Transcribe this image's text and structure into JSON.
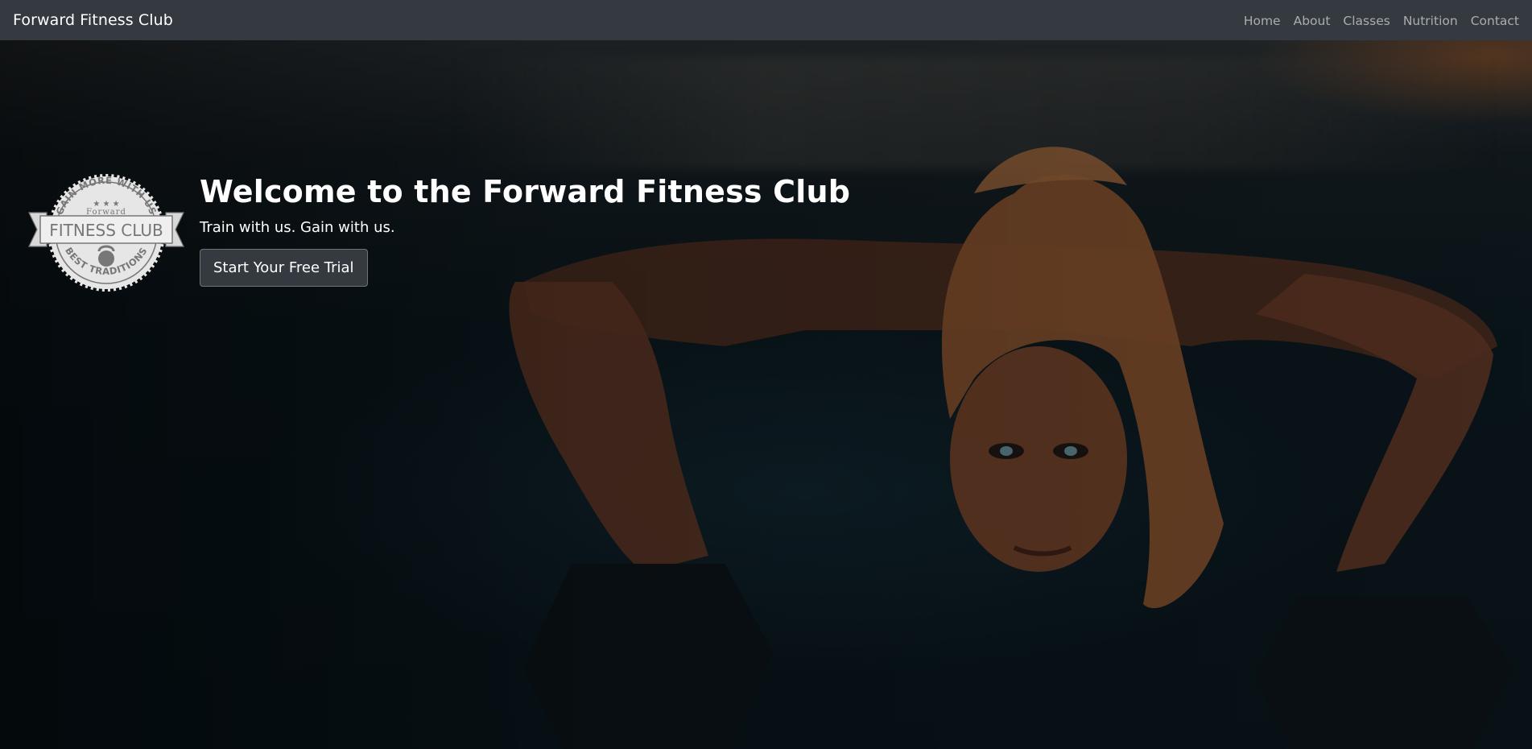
{
  "navbar": {
    "brand": "Forward Fitness Club",
    "links": [
      {
        "label": "Home"
      },
      {
        "label": "About"
      },
      {
        "label": "Classes"
      },
      {
        "label": "Nutrition"
      },
      {
        "label": "Contact"
      }
    ]
  },
  "hero": {
    "title": "Welcome to the Forward Fitness Club",
    "subtitle": "Train with us. Gain with us.",
    "cta_label": "Start Your Free Trial",
    "background_image": "woman-doing-push-ups-on-dumbbells"
  },
  "logo": {
    "icon": "kettlebell-icon",
    "top_arc": "GAIN MORE WITH US",
    "upper_text": "Forward",
    "banner": "FITNESS CLUB",
    "bottom_arc": "BEST TRADITIONS"
  },
  "colors": {
    "navbar_bg": "#343a40",
    "nav_link": "#9a9da0",
    "button_bg": "#343a40",
    "button_border": "#6c757d",
    "text": "#ffffff",
    "logo_fill": "#e6e6e6",
    "logo_ink": "#777777"
  }
}
